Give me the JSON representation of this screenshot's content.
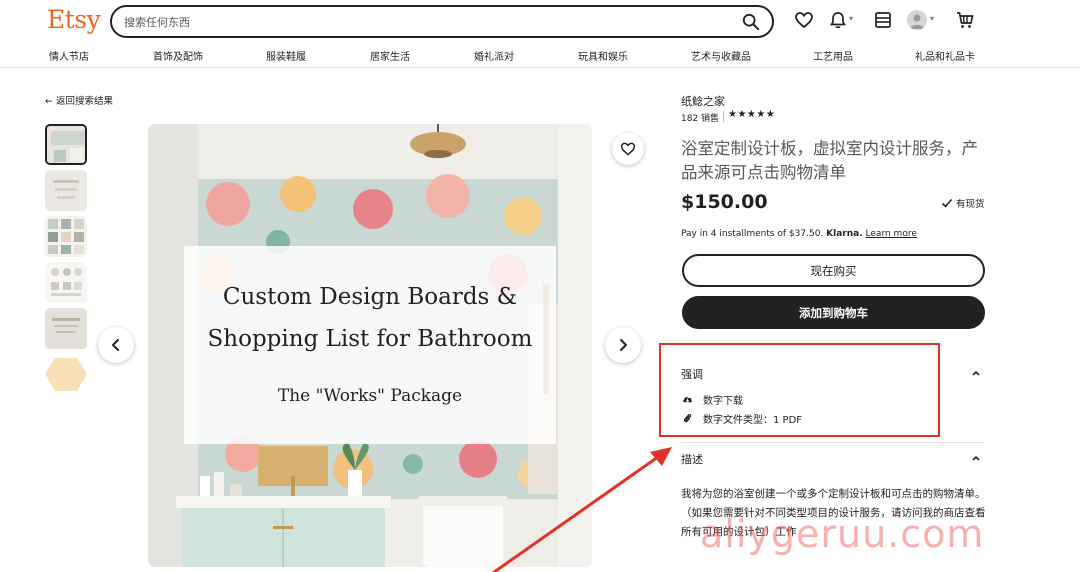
{
  "header": {
    "logo": "Etsy",
    "search_placeholder": "搜索任何东西",
    "icons": [
      "search-icon",
      "heart-icon",
      "bell-icon",
      "shop-icon",
      "avatar",
      "cart-icon"
    ]
  },
  "categories": [
    "情人节店",
    "首饰及配饰",
    "服装鞋履",
    "居家生活",
    "婚礼派对",
    "玩具和娱乐",
    "艺术与收藏品",
    "工艺用品",
    "礼品和礼品卡"
  ],
  "nav": {
    "back_label": "← 返回搜索结果"
  },
  "image_overlay": {
    "line1": "Custom Design Boards &",
    "line2": "Shopping List for Bathroom",
    "line3": "The \"Works\" Package"
  },
  "listing": {
    "shop_name": "纸鲶之家",
    "sales": "182 销售",
    "rating_stars": "★★★★★",
    "title": "浴室定制设计板，虚拟室内设计服务，产品来源可点击购物清单",
    "price": "$150.00",
    "stock": "有现货",
    "klarna_prefix": "Pay in 4 installments of $37.50.",
    "klarna_brand": "Klarna.",
    "klarna_link": "Learn more",
    "buy_now": "现在购买",
    "add_to_cart": "添加到购物车"
  },
  "highlights": {
    "title": "强调",
    "items": [
      "数字下载",
      "数字文件类型：1 PDF"
    ]
  },
  "description": {
    "title": "描述",
    "text1": "我将为您的浴室创建一个或多个定制设计板和可点击的购物清单。",
    "text2": "（如果您需要针对不同类型项目的设计服务，请访问我的商店查看所有可用的设计包）工作"
  },
  "watermark": "aliygeruu.com",
  "colors": {
    "brand": "#f1641e",
    "highlight_border": "#e43127",
    "text": "#222222"
  }
}
